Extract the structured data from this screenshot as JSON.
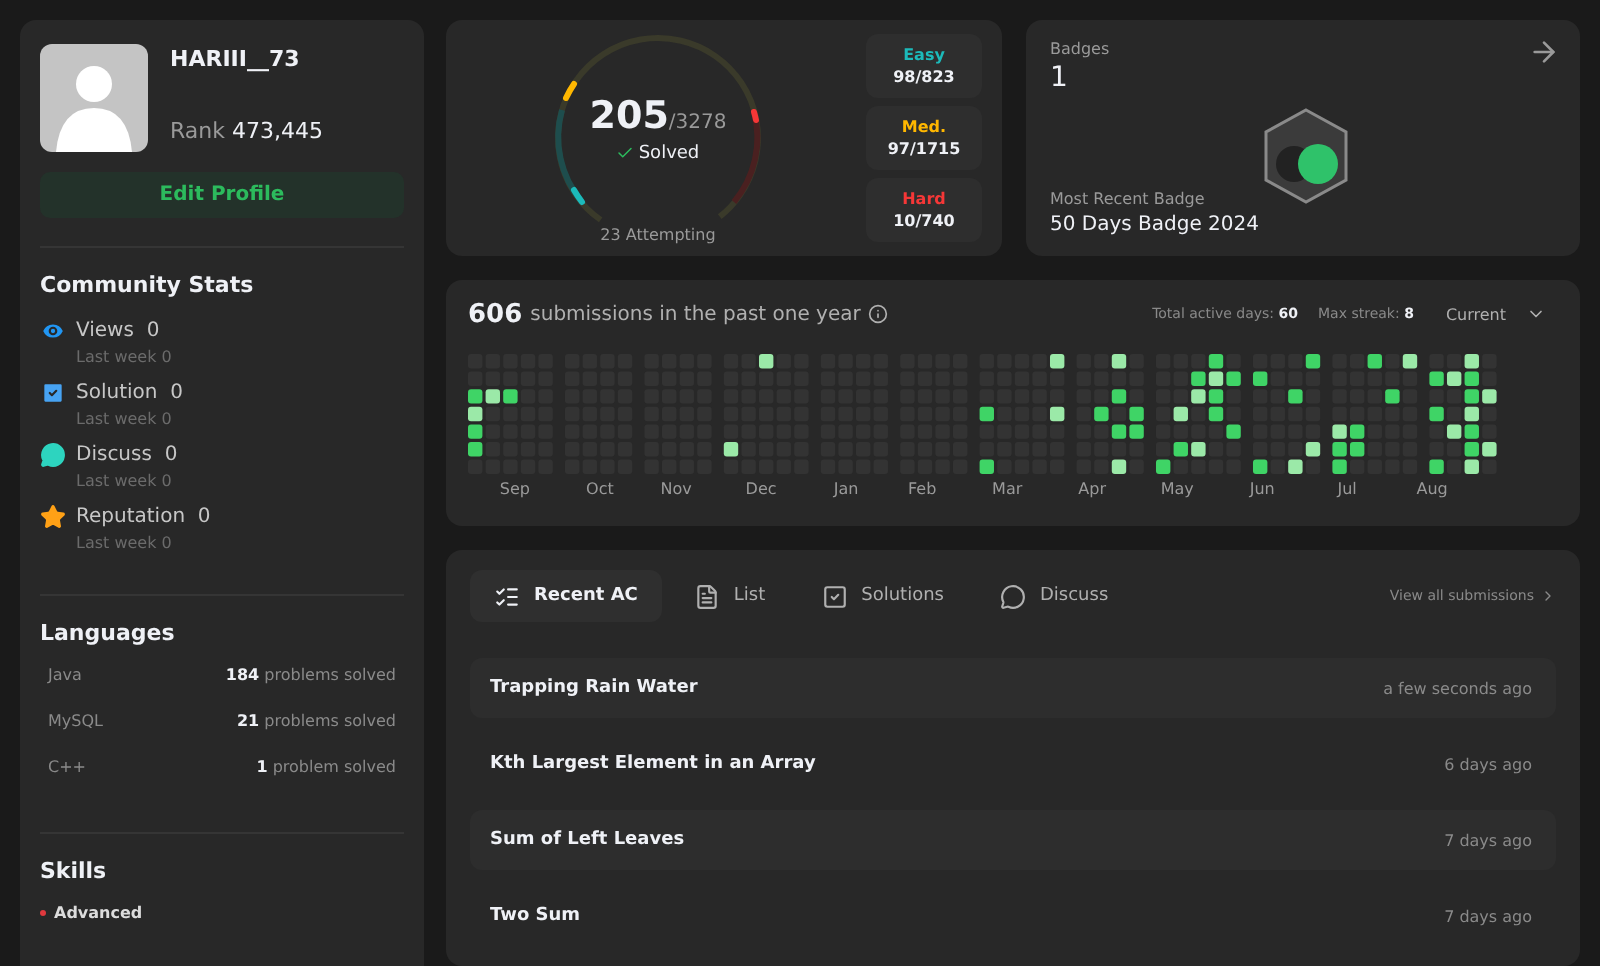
{
  "profile": {
    "username": "HARIII__73",
    "rank_label": "Rank",
    "rank": "473,445",
    "edit_button": "Edit Profile"
  },
  "community_stats": {
    "title": "Community Stats",
    "items": [
      {
        "kind": "views",
        "label": "Views",
        "value": "0",
        "sub_label": "Last week",
        "sub_value": "0"
      },
      {
        "kind": "solution",
        "label": "Solution",
        "value": "0",
        "sub_label": "Last week",
        "sub_value": "0"
      },
      {
        "kind": "discuss",
        "label": "Discuss",
        "value": "0",
        "sub_label": "Last week",
        "sub_value": "0"
      },
      {
        "kind": "reputation",
        "label": "Reputation",
        "value": "0",
        "sub_label": "Last week",
        "sub_value": "0"
      }
    ]
  },
  "languages": {
    "title": "Languages",
    "items": [
      {
        "name": "Java",
        "count": "184",
        "unit": "problems solved"
      },
      {
        "name": "MySQL",
        "count": "21",
        "unit": "problems solved"
      },
      {
        "name": "C++",
        "count": "1",
        "unit": "problem solved"
      }
    ]
  },
  "skills": {
    "title": "Skills",
    "items": [
      {
        "label": "Advanced",
        "color": "#e0393e"
      }
    ]
  },
  "solved": {
    "count": "205",
    "total": "/3278",
    "label": "Solved",
    "attempting": "23 Attempting",
    "difficulties": [
      {
        "label": "Easy",
        "value": "98/823",
        "color": "#1cbaba"
      },
      {
        "label": "Med.",
        "value": "97/1715",
        "color": "#ffb700"
      },
      {
        "label": "Hard",
        "value": "10/740",
        "color": "#f63737"
      }
    ]
  },
  "badges": {
    "title": "Badges",
    "count": "1",
    "recent_label": "Most Recent Badge",
    "recent_name": "50 Days Badge 2024"
  },
  "heatmap": {
    "count": "606",
    "title": "submissions in the past one year",
    "active_label": "Total active days:",
    "active_value": "60",
    "streak_label": "Max streak:",
    "streak_value": "8",
    "period": "Current",
    "months": [
      "Sep",
      "Oct",
      "Nov",
      "Dec",
      "Jan",
      "Feb",
      "Mar",
      "Apr",
      "May",
      "Jun",
      "Jul",
      "Aug"
    ]
  },
  "recent": {
    "tabs": [
      {
        "kind": "recent",
        "label": "Recent AC",
        "selected": true
      },
      {
        "kind": "list",
        "label": "List",
        "selected": false
      },
      {
        "kind": "solutions",
        "label": "Solutions",
        "selected": false
      },
      {
        "kind": "discuss",
        "label": "Discuss",
        "selected": false
      }
    ],
    "view_all": "View all submissions",
    "rows": [
      {
        "title": "Trapping Rain Water",
        "time": "a few seconds ago"
      },
      {
        "title": "Kth Largest Element in an Array",
        "time": "6 days ago"
      },
      {
        "title": "Sum of Left Leaves",
        "time": "7 days ago"
      },
      {
        "title": "Two Sum",
        "time": "7 days ago"
      }
    ]
  }
}
